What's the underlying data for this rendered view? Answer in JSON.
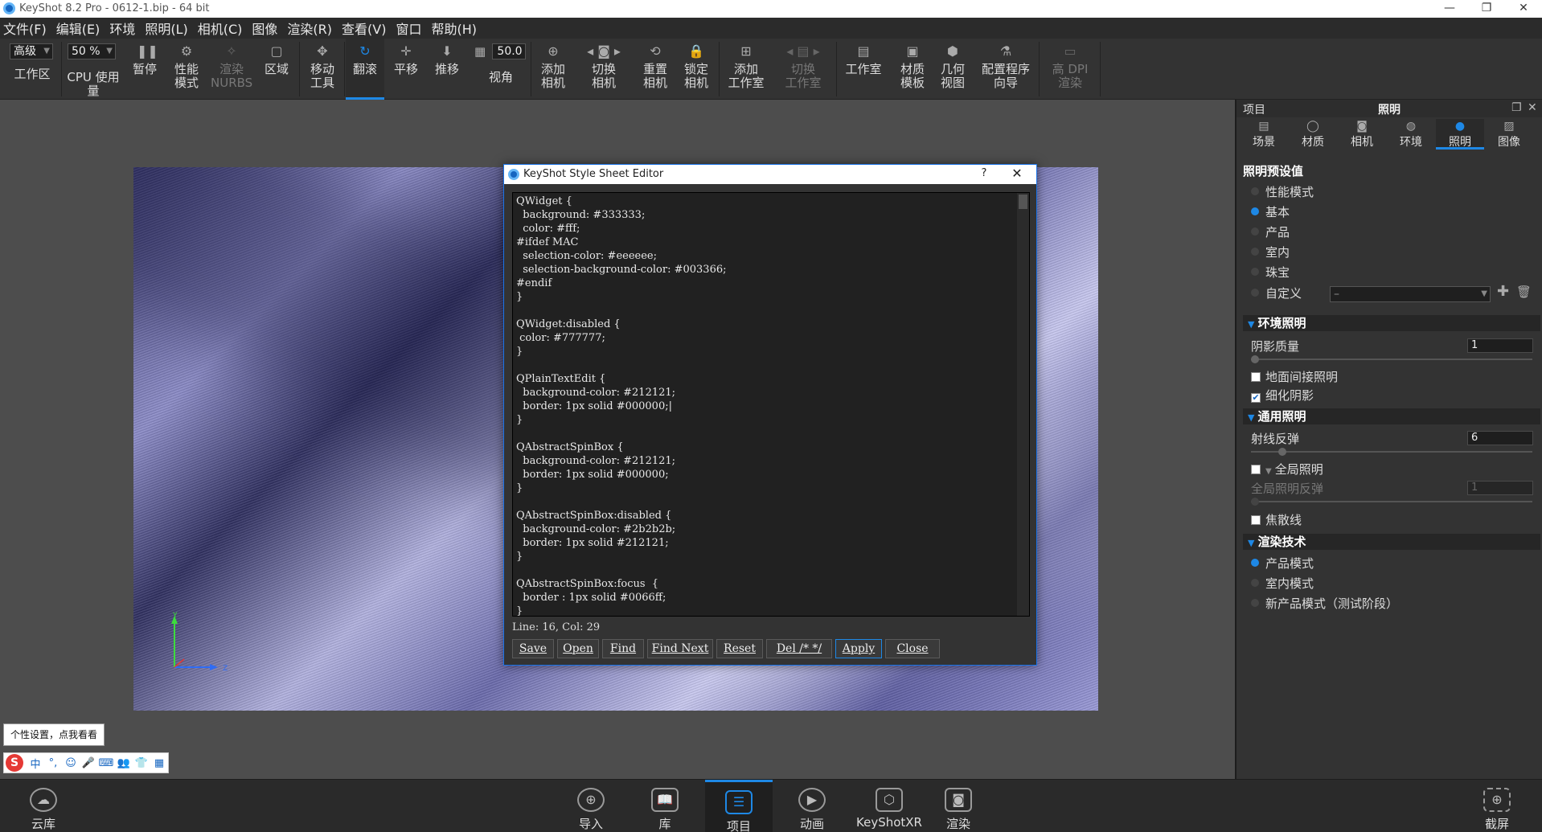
{
  "window": {
    "title": "KeyShot 8.2 Pro  - 0612-1.bip  - 64 bit",
    "controls": [
      "—",
      "❐",
      "✕"
    ]
  },
  "menu": [
    "文件(F)",
    "编辑(E)",
    "环境",
    "照明(L)",
    "相机(C)",
    "图像",
    "渲染(R)",
    "查看(V)",
    "窗口",
    "帮助(H)"
  ],
  "toolbar": {
    "workspace_select": "高级",
    "workspace_label": "工作区",
    "cpu_select": "50 %",
    "cpu_label": "CPU 使用量",
    "pause": "暂停",
    "perf_mode": [
      "性能",
      "模式"
    ],
    "render_nurbs": [
      "渲染",
      "NURBS"
    ],
    "region": "区域",
    "move_tool": [
      "移动",
      "工具"
    ],
    "tumble": "翻滚",
    "pan": "平移",
    "dolly": "推移",
    "fov_value": "50.0",
    "fov_label": "视角",
    "add_camera": [
      "添加",
      "相机"
    ],
    "switch_camera": [
      "切换",
      "相机"
    ],
    "reset_camera": [
      "重置",
      "相机"
    ],
    "lock_camera": [
      "锁定",
      "相机"
    ],
    "add_studio": [
      "添加",
      "工作室"
    ],
    "switch_studio": [
      "切换",
      "工作室"
    ],
    "studio": "工作室",
    "material_template": [
      "材质",
      "模板"
    ],
    "geometry_view": [
      "几何",
      "视图"
    ],
    "config_wizard": [
      "配置程序",
      "向导"
    ],
    "hidpi": [
      "高 DPI",
      "渲染"
    ]
  },
  "dialog": {
    "title": "KeyShot Style Sheet Editor",
    "help": "?",
    "close_x": "✕",
    "code": "QWidget {\n  background: #333333;\n  color: #fff;\n#ifdef MAC\n  selection-color: #eeeeee;\n  selection-background-color: #003366;\n#endif\n}\n\nQWidget:disabled {\n color: #777777;\n}\n\nQPlainTextEdit {\n  background-color: #212121;\n  border: 1px solid #000000;|\n}\n\nQAbstractSpinBox {\n  background-color: #212121;\n  border: 1px solid #000000;\n}\n\nQAbstractSpinBox:disabled {\n  background-color: #2b2b2b;\n  border: 1px solid #212121;\n}\n\nQAbstractSpinBox:focus  {\n  border : 1px solid #0066ff;\n}",
    "status": "Line: 16, Col: 29",
    "buttons": {
      "save": "Save",
      "open": "Open",
      "find": "Find",
      "find_next": "Find Next",
      "reset": "Reset",
      "del_comment": "Del /* */",
      "apply": "Apply",
      "close": "Close"
    }
  },
  "gizmo": {
    "y": "Y",
    "z": "Z"
  },
  "ime": {
    "tip": "个性设置，点我看看",
    "logo": "S",
    "items": [
      "中",
      "°,",
      "☺",
      "🎤",
      "⌨",
      "👥",
      "👕",
      "▦"
    ]
  },
  "panel": {
    "left_title": "项目",
    "center_title": "照明",
    "tabs": [
      "场景",
      "材质",
      "相机",
      "环境",
      "照明",
      "图像"
    ],
    "presets_title": "照明预设值",
    "presets": [
      "性能模式",
      "基本",
      "产品",
      "室内",
      "珠宝",
      "自定义"
    ],
    "custom_value": "–",
    "env_section": "环境照明",
    "shadow_quality_label": "阴影质量",
    "shadow_quality_value": "1",
    "ground_indirect": "地面间接照明",
    "refine_shadows": "细化阴影",
    "general_section": "通用照明",
    "ray_bounces_label": "射线反弹",
    "ray_bounces_value": "6",
    "global_illumination": "全局照明",
    "gi_bounces_label": "全局照明反弹",
    "gi_bounces_value": "1",
    "caustics": "焦散线",
    "render_tech_section": "渲染技术",
    "render_modes": [
      "产品模式",
      "室内模式",
      "新产品模式（测试阶段）"
    ]
  },
  "bottombar": {
    "cloud": "云库",
    "import": "导入",
    "library": "库",
    "project": "项目",
    "animation": "动画",
    "keyshotxr": "KeyShotXR",
    "render": "渲染",
    "screenshot": "截屏"
  },
  "colors": {
    "accent": "#1e88e5",
    "panel_bg": "#333333",
    "editor_bg": "#212121"
  }
}
